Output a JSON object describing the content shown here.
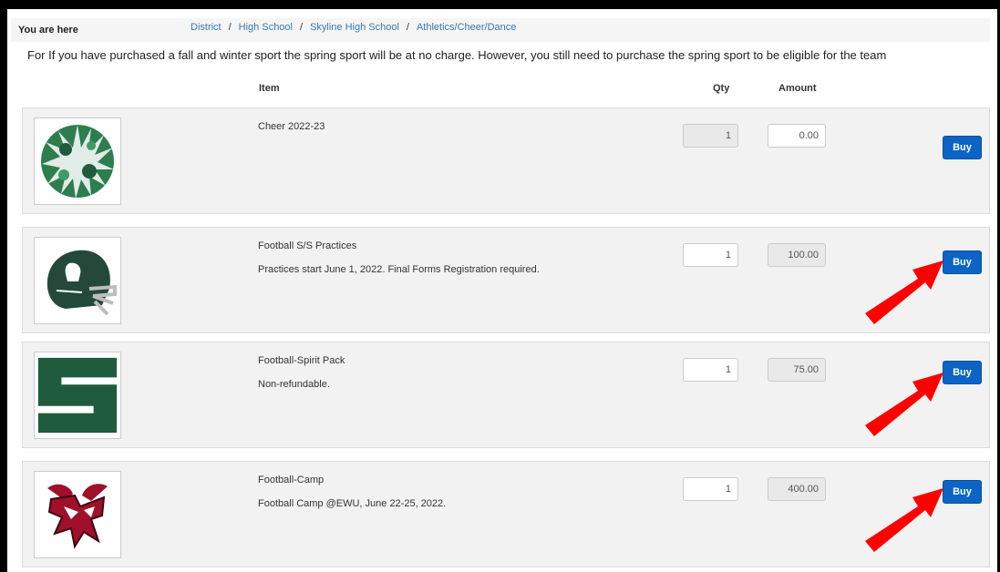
{
  "breadcrumb": {
    "label": "You are here",
    "items": [
      "District",
      "High School",
      "Skyline High School",
      "Athletics/Cheer/Dance"
    ],
    "separator": "/"
  },
  "notice": "For If you have purchased a fall and winter sport the spring sport will be at no charge.  However, you still need to purchase the spring sport to be eligible for the team",
  "columns": {
    "item": "Item",
    "qty": "Qty",
    "amount": "Amount"
  },
  "items": [
    {
      "name": "Cheer 2022-23",
      "description": "",
      "qty": "1",
      "amount": "0.00",
      "buy_label": "Buy",
      "image_icon": "green-white-pompom-icon"
    },
    {
      "name": "Football S/S Practices",
      "description": "Practices start June 1, 2022. Final Forms Registration required.",
      "qty": "1",
      "amount": "100.00",
      "buy_label": "Buy",
      "image_icon": "spartan-football-helmet-icon"
    },
    {
      "name": "Football-Spirit Pack",
      "description": "Non-refundable.",
      "qty": "1",
      "amount": "75.00",
      "buy_label": "Buy",
      "image_icon": "block-letter-s-icon"
    },
    {
      "name": "Football-Camp",
      "description": "Football Camp @EWU, June 22-25, 2022.",
      "qty": "1",
      "amount": "400.00",
      "buy_label": "Buy",
      "image_icon": "ewu-eagle-logo"
    }
  ],
  "colors": {
    "buy_button": "#0b64c6",
    "link": "#337ab7",
    "school_green": "#1f5c3d",
    "ewu_red": "#a0102a",
    "annotation_arrow": "#ff0000"
  }
}
